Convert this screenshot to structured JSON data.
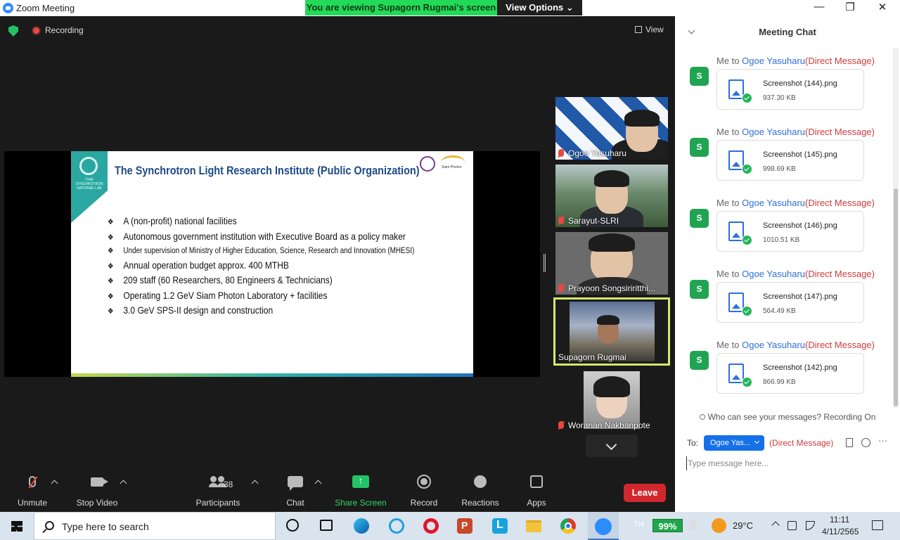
{
  "window": {
    "title": "Zoom Meeting",
    "viewing_banner": "You are viewing Supagorn Rugmai's screen",
    "view_options": "View Options",
    "view_options_caret": "⌄",
    "minimize": "—",
    "maximize": "❐",
    "close": "✕"
  },
  "meeting": {
    "recording": "Recording",
    "view": "View"
  },
  "slide": {
    "logo_text": "THAI SYNCHROTRON NATIONAL LAB",
    "title": "The Synchrotron Light Research Institute (Public Organization)",
    "siam_label": "Siam Photon",
    "bullet_glyph": "❖",
    "bullets": [
      "A (non-profit) national facilities",
      "Autonomous government institution with Executive Board as a policy maker",
      "Under supervision of Ministry of Higher Education, Science, Research and Innovation (MHESI)",
      "Annual operation budget approx. 400 MTHB",
      "209 staff (60 Researchers, 80 Engineers & Technicians)",
      "Operating 1.2 GeV Siam Photon Laboratory + facilities",
      "3.0 GeV SPS-II design and construction"
    ]
  },
  "participants": [
    {
      "name": "Ogoe Yasuharu",
      "muted": true
    },
    {
      "name": "Sarayut-SLRI",
      "muted": true
    },
    {
      "name": "Prayoon Songsiriritthi...",
      "muted": true
    },
    {
      "name": "Supagorn Rugmai",
      "muted": false,
      "active": true
    },
    {
      "name": "Woranan Nakbanpote",
      "muted": true
    }
  ],
  "toolbar": {
    "unmute": "Unmute",
    "stop_video": "Stop Video",
    "participants": "Participants",
    "participant_count": "38",
    "chat": "Chat",
    "share_screen": "Share Screen",
    "record": "Record",
    "reactions": "Reactions",
    "apps": "Apps",
    "leave": "Leave"
  },
  "chat": {
    "title": "Meeting Chat",
    "messages": [
      {
        "avatar": "S",
        "from": "Me to",
        "to": "Ogoe Yasuharu",
        "tag": "(Direct Message)",
        "file": "Screenshot (144).png",
        "size": "937.30 KB"
      },
      {
        "avatar": "S",
        "from": "Me to",
        "to": "Ogoe Yasuharu",
        "tag": "(Direct Message)",
        "file": "Screenshot (145).png",
        "size": "998.69 KB"
      },
      {
        "avatar": "S",
        "from": "Me to",
        "to": "Ogoe Yasuharu",
        "tag": "(Direct Message)",
        "file": "Screenshot (146).png",
        "size": "1010.51 KB"
      },
      {
        "avatar": "S",
        "from": "Me to",
        "to": "Ogoe Yasuharu",
        "tag": "(Direct Message)",
        "file": "Screenshot (147).png",
        "size": "564.49 KB"
      },
      {
        "avatar": "S",
        "from": "Me to",
        "to": "Ogoe Yasuharu",
        "tag": "(Direct Message)",
        "file": "Screenshot (142).png",
        "size": "866.99 KB"
      }
    ],
    "notice": "Who can see your messages? Recording On",
    "to_label": "To:",
    "recipient": "Ogoe Yas...",
    "recipient_tag": "(Direct Message)",
    "more": "···",
    "placeholder": "Type message here..."
  },
  "taskbar": {
    "search": "Type here to search",
    "lang": "TH",
    "battery": "99%",
    "temperature": "29°C",
    "time": "11:11",
    "date": "4/11/2565"
  }
}
